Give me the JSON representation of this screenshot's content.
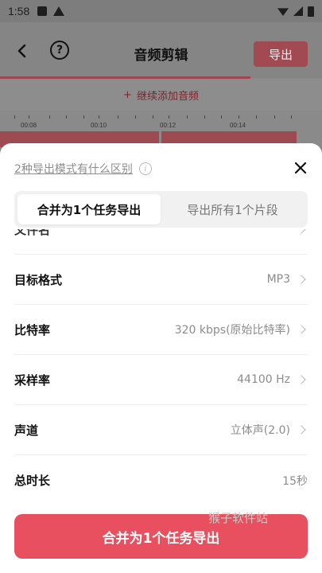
{
  "status_bar": {
    "time": "1:58"
  },
  "app_bar": {
    "title": "音频剪辑",
    "export_label": "导出"
  },
  "add_audio": {
    "label": "继续添加音频"
  },
  "timeline": {
    "ticks": [
      "00:08",
      "00:10",
      "00:12",
      "00:14"
    ]
  },
  "sheet": {
    "diff_link": "2种导出模式有什么区别",
    "tabs": [
      {
        "label": "合并为1个任务导出",
        "selected": true
      },
      {
        "label": "导出所有1个片段",
        "selected": false
      }
    ],
    "rows": [
      {
        "label": "文件名",
        "value": ""
      },
      {
        "label": "目标格式",
        "value": "MP3"
      },
      {
        "label": "比特率",
        "value": "320 kbps(原始比特率)"
      },
      {
        "label": "采样率",
        "value": "44100 Hz"
      },
      {
        "label": "声道",
        "value": "立体声(2.0)"
      },
      {
        "label": "总时长",
        "value": "15秒"
      }
    ],
    "export_button": "合并为1个任务导出",
    "watermark": "猴子软件站"
  },
  "colors": {
    "accent": "#e9505f",
    "accent_dim": "#a24a51"
  }
}
